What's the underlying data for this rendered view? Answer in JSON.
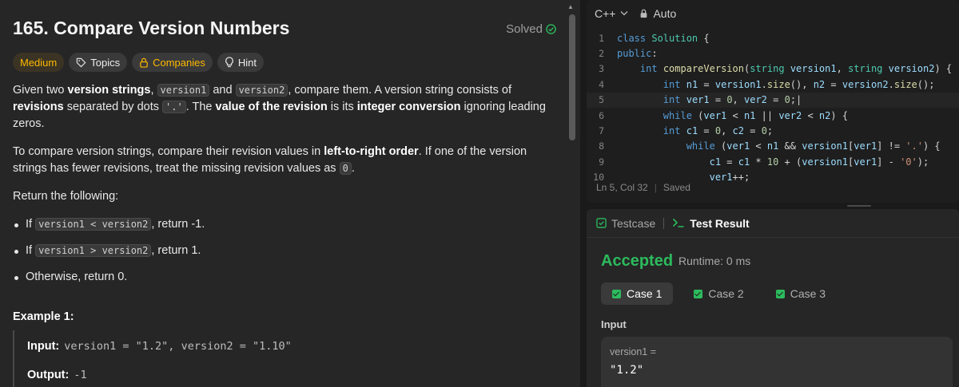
{
  "problem": {
    "title": "165. Compare Version Numbers",
    "status": "Solved",
    "tags": {
      "difficulty": "Medium",
      "topics": "Topics",
      "companies": "Companies",
      "hint": "Hint"
    },
    "para1": {
      "t1": "Given two ",
      "b1": "version strings",
      "t2": ", ",
      "c1": "version1",
      "t3": " and ",
      "c2": "version2",
      "t4": ", compare them. A version string consists of ",
      "b2": "revisions",
      "t5": " separated by dots ",
      "c3": "'.'",
      "t6": ". The ",
      "b3": "value of the revision",
      "t7": " is its ",
      "b4": "integer conversion",
      "t8": " ignoring leading zeros."
    },
    "para2": {
      "t1": "To compare version strings, compare their revision values in ",
      "b1": "left-to-right order",
      "t2": ". If one of the version strings has fewer revisions, treat the missing revision values as ",
      "c1": "0",
      "t3": "."
    },
    "para3": "Return the following:",
    "bullets": [
      {
        "pre": "If ",
        "code": "version1 < version2",
        "post": ", return -1."
      },
      {
        "pre": "If ",
        "code": "version1 > version2",
        "post": ", return 1."
      },
      {
        "pre": "Otherwise, return 0.",
        "code": "",
        "post": ""
      }
    ],
    "example": {
      "title": "Example 1:",
      "input_label": "Input:",
      "input_value": "version1 = \"1.2\", version2 = \"1.10\"",
      "output_label": "Output:",
      "output_value": "-1"
    }
  },
  "editor": {
    "language": "C++",
    "mode": "Auto",
    "status_position": "Ln 5, Col 32",
    "status_saved": "Saved",
    "line_numbers": [
      "1",
      "2",
      "3",
      "4",
      "5",
      "6",
      "7",
      "8",
      "9",
      "10"
    ]
  },
  "results": {
    "tab_testcase": "Testcase",
    "tab_result": "Test Result",
    "verdict": "Accepted",
    "runtime": "Runtime: 0 ms",
    "cases": [
      "Case 1",
      "Case 2",
      "Case 3"
    ],
    "input_label": "Input",
    "var_name": "version1 =",
    "var_value": "\"1.2\""
  },
  "colors": {
    "accent_green": "#2cbb5d",
    "medium": "#ffb800"
  }
}
